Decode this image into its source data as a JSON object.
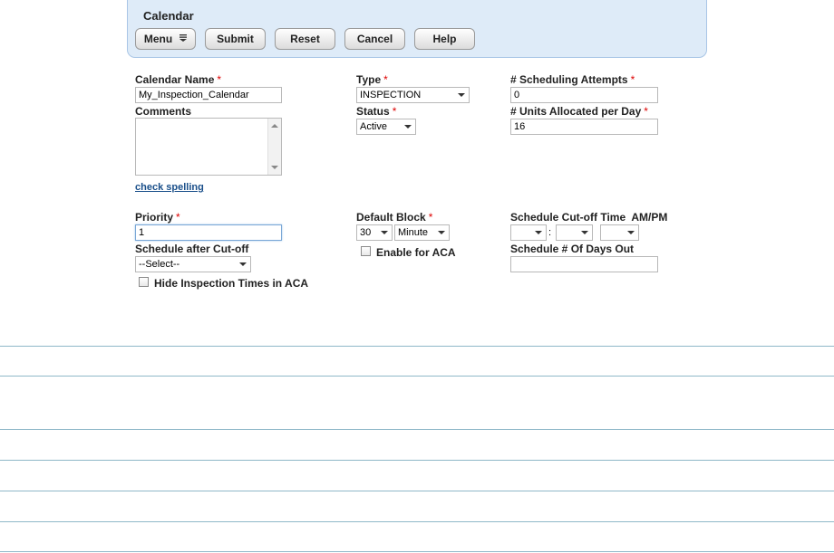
{
  "panel": {
    "title": "Calendar",
    "buttons": {
      "menu": "Menu",
      "submit": "Submit",
      "reset": "Reset",
      "cancel": "Cancel",
      "help": "Help"
    }
  },
  "form": {
    "required_mark": "*",
    "calendar_name": {
      "label": "Calendar Name",
      "value": "My_Inspection_Calendar"
    },
    "comments": {
      "label": "Comments",
      "value": ""
    },
    "check_spelling": "check spelling",
    "type": {
      "label": "Type",
      "value": "INSPECTION"
    },
    "status": {
      "label": "Status",
      "value": "Active"
    },
    "scheduling_attempts": {
      "label": "# Scheduling Attempts",
      "value": "0"
    },
    "units_allocated": {
      "label": "# Units Allocated per Day",
      "value": "16"
    },
    "priority": {
      "label": "Priority",
      "value": "1"
    },
    "schedule_after_cutoff": {
      "label": "Schedule after Cut-off",
      "value": "--Select--"
    },
    "hide_inspection_times": {
      "label": "Hide Inspection Times in ACA",
      "checked": false
    },
    "default_block": {
      "label": "Default Block",
      "amount": "30",
      "unit": "Minute"
    },
    "enable_aca": {
      "label": "Enable for ACA",
      "checked": false
    },
    "cutoff_time": {
      "label": "Schedule Cut-off Time  AM/PM",
      "hour": "",
      "minute": "",
      "ampm": "",
      "separator": ":"
    },
    "days_out": {
      "label": "Schedule # Of Days Out",
      "value": ""
    }
  },
  "colors": {
    "panel_bg": "#deebf8",
    "panel_border": "#a9c6e6",
    "required": "#dd0000",
    "link": "#1a4f8a",
    "rule": "#8fb8c8"
  }
}
